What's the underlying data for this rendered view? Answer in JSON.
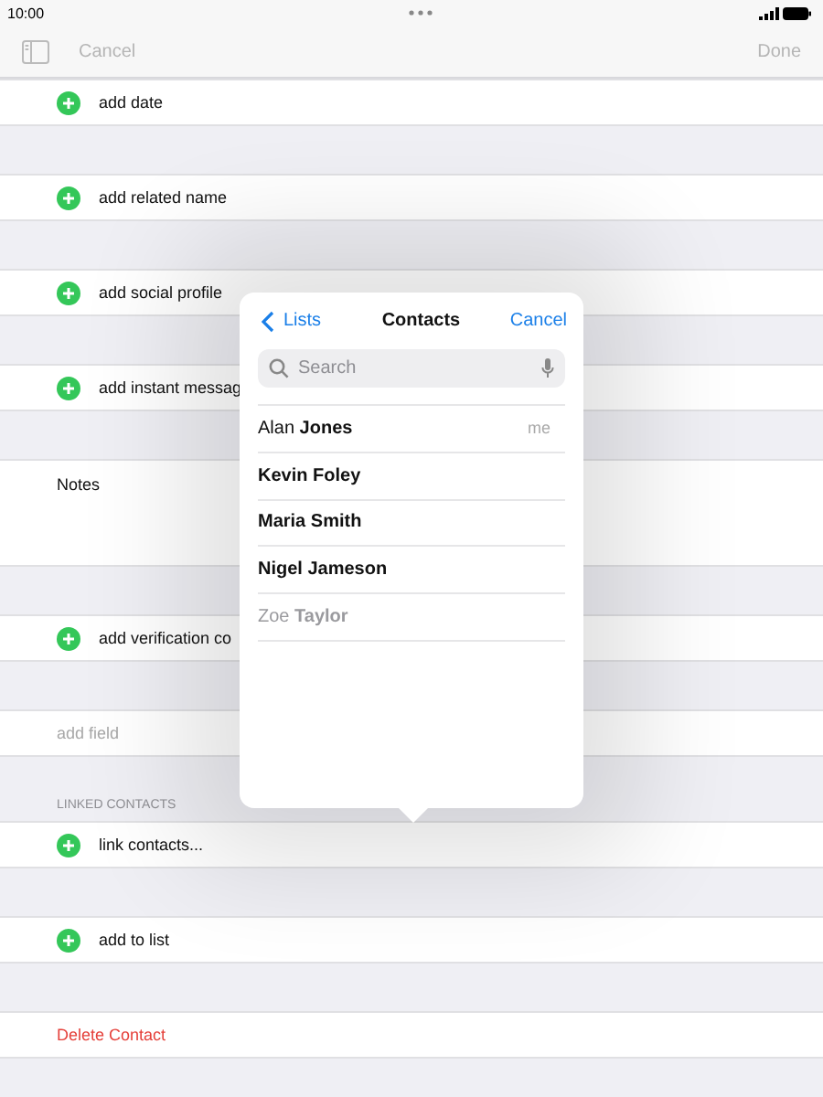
{
  "status_bar": {
    "time": "10:00"
  },
  "nav_bar": {
    "cancel": "Cancel",
    "done": "Done"
  },
  "form_rows": [
    {
      "kind": "add",
      "label": "add date"
    },
    {
      "kind": "add",
      "label": "add related name"
    },
    {
      "kind": "add",
      "label": "add social profile"
    },
    {
      "kind": "add",
      "label": "add instant messag"
    },
    {
      "kind": "notes",
      "label": "Notes"
    },
    {
      "kind": "add",
      "label": "add verification co"
    },
    {
      "kind": "field",
      "label": "add field"
    },
    {
      "kind": "header",
      "label": "LINKED CONTACTS"
    },
    {
      "kind": "add",
      "label": "link contacts..."
    },
    {
      "kind": "add",
      "label": "add to list"
    },
    {
      "kind": "delete",
      "label": "Delete Contact"
    }
  ],
  "popover": {
    "back": "Lists",
    "title": "Contacts",
    "cancel": "Cancel",
    "search": {
      "placeholder": "Search"
    },
    "contacts": [
      {
        "name": "Alan **Jones**",
        "badge": "me",
        "disabled": false
      },
      {
        "name": "**Kevin Foley**",
        "disabled": false
      },
      {
        "name": "**Maria Smith**",
        "disabled": false
      },
      {
        "name": "**Nigel Jameson**",
        "disabled": false
      },
      {
        "name": "Zoe **Taylor**",
        "disabled": true
      }
    ]
  }
}
